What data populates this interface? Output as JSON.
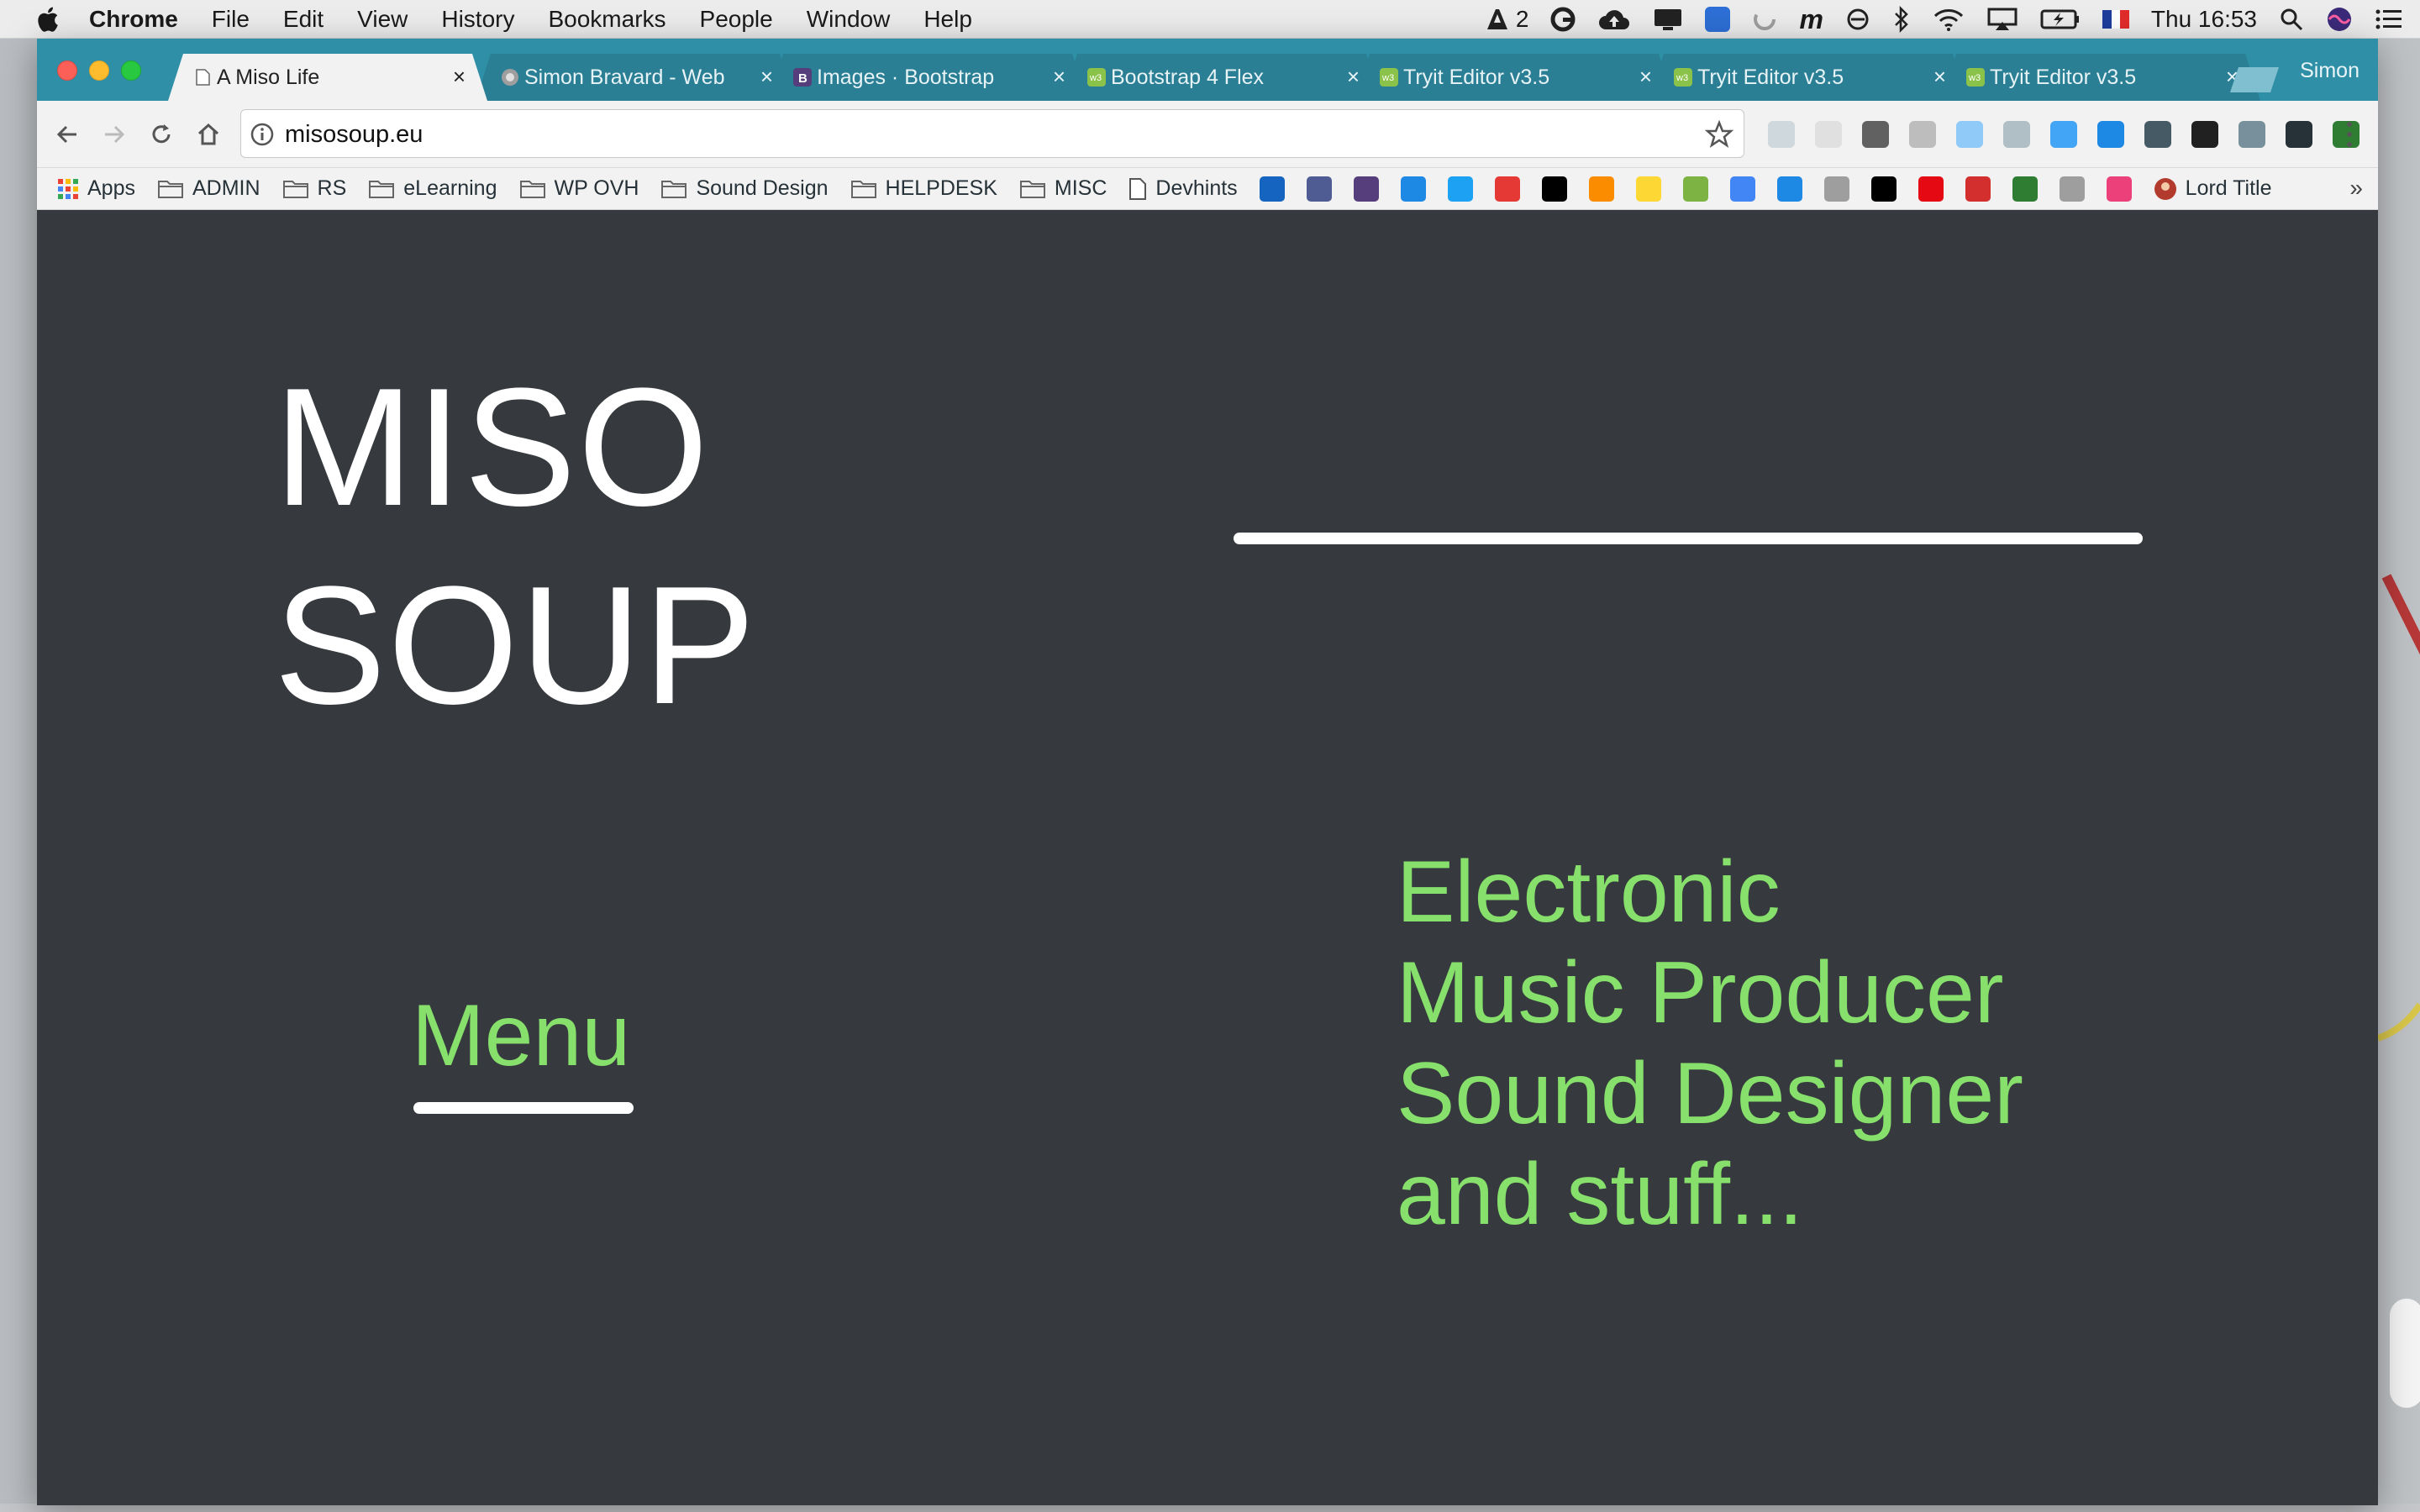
{
  "menubar": {
    "app_name": "Chrome",
    "menus": [
      "File",
      "Edit",
      "View",
      "History",
      "Bookmarks",
      "People",
      "Window",
      "Help"
    ],
    "adobe_count": "2",
    "clock": "Thu 16:53"
  },
  "browser": {
    "tabs": [
      {
        "title": "A Miso Life",
        "active": true,
        "favicon_color": "#ffffff"
      },
      {
        "title": "Simon Bravard - Web",
        "active": false,
        "favicon_color": "#9e9e9e"
      },
      {
        "title": "Images · Bootstrap",
        "active": false,
        "favicon_color": "#563d7c"
      },
      {
        "title": "Bootstrap 4 Flex",
        "active": false,
        "favicon_color": "#8bc34a"
      },
      {
        "title": "Tryit Editor v3.5",
        "active": false,
        "favicon_color": "#8bc34a"
      },
      {
        "title": "Tryit Editor v3.5",
        "active": false,
        "favicon_color": "#8bc34a"
      },
      {
        "title": "Tryit Editor v3.5",
        "active": false,
        "favicon_color": "#8bc34a"
      }
    ],
    "profile_name": "Simon",
    "url": "misosoup.eu",
    "bookmarks": {
      "apps": "Apps",
      "folders": [
        "ADMIN",
        "RS",
        "eLearning",
        "WP OVH",
        "Sound Design",
        "HELPDESK",
        "MISC"
      ],
      "page_link": "Devhints",
      "icon_colors": [
        "#1565c0",
        "#4f5b93",
        "#563d7c",
        "#1e88e5",
        "#1da1f2",
        "#e53935",
        "#000000",
        "#fb8c00",
        "#fdd835",
        "#7cb342",
        "#4285f4",
        "#1e88e5",
        "#9e9e9e",
        "#000000",
        "#e50914",
        "#d32f2f",
        "#2e7d32",
        "#9e9e9e",
        "#ec407a"
      ],
      "last": "Lord Title"
    },
    "extension_colors": [
      "#cfd8dc",
      "#e0e0e0",
      "#616161",
      "#bdbdbd",
      "#90caf9",
      "#b0bec5",
      "#42a5f5",
      "#1e88e5",
      "#455a64",
      "#212121",
      "#78909c",
      "#263238",
      "#2e7d32"
    ]
  },
  "page": {
    "title_line1": "MISO",
    "title_line2": "SOUP",
    "menu_link": "Menu",
    "tagline": [
      "Electronic",
      "Music Producer",
      "Sound Designer",
      "and stuff..."
    ],
    "accent_color": "#86e06b",
    "background_color": "#36393e"
  }
}
